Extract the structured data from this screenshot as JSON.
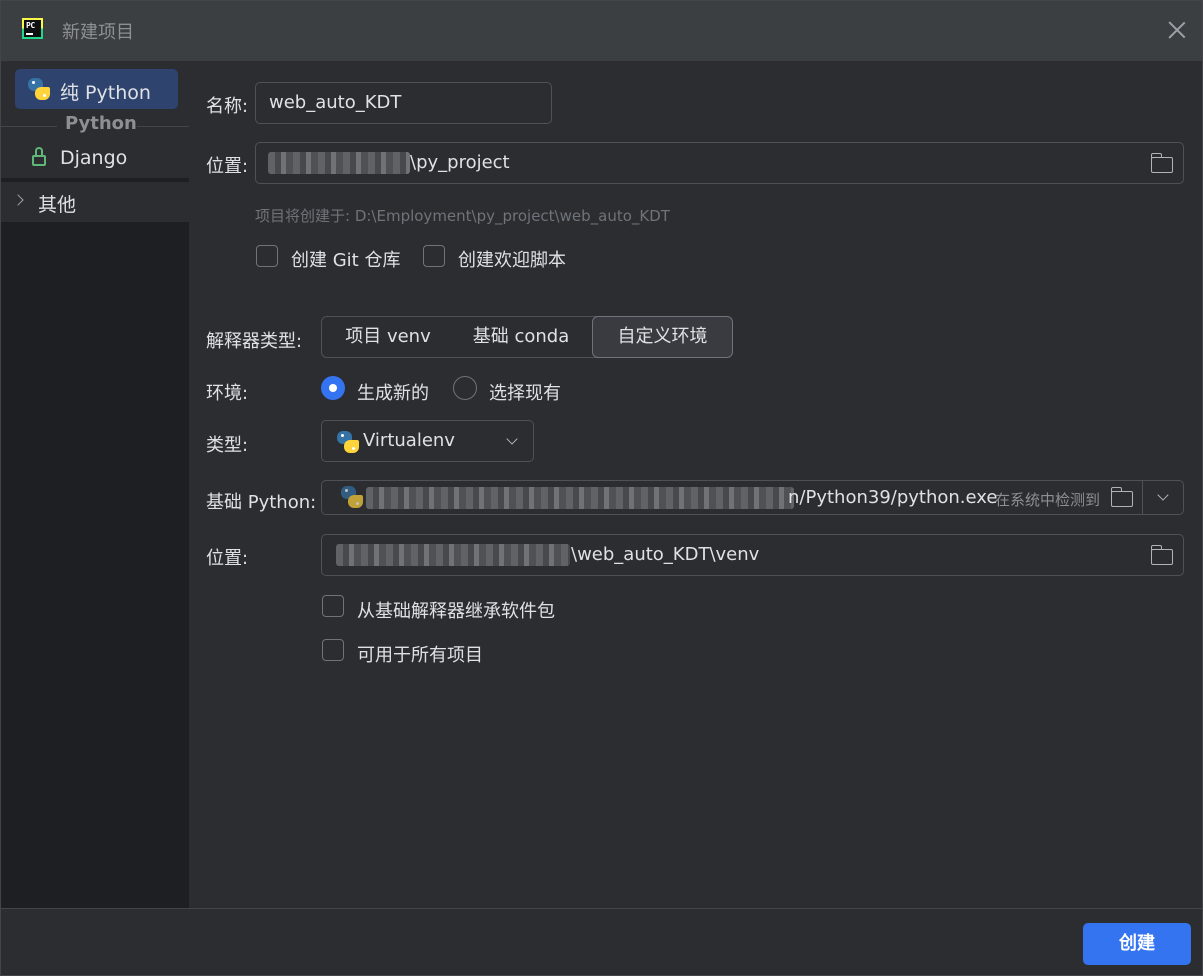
{
  "window": {
    "title": "新建项目"
  },
  "sidebar": {
    "items": [
      {
        "label": "纯 Python",
        "icon": "python-icon",
        "selected": true
      },
      {
        "label": "Django",
        "icon": "lock-icon"
      },
      {
        "label": "其他",
        "icon": "chevron-right-icon"
      }
    ],
    "group_label": "Python"
  },
  "form": {
    "name_label": "名称:",
    "name_value": "web_auto_KDT",
    "location_label": "位置:",
    "location_value": "\\py_project",
    "hint": "项目将创建于: D:\\Employment\\py_project\\web_auto_KDT",
    "git_label": "创建 Git 仓库",
    "welcome_label": "创建欢迎脚本",
    "interp_type_label": "解释器类型:",
    "interp_types": [
      "项目 venv",
      "基础 conda",
      "自定义环境"
    ],
    "interp_selected": "自定义环境",
    "env_label": "环境:",
    "env_new": "生成新的",
    "env_existing": "选择现有",
    "env_selected": "生成新的",
    "type_label": "类型:",
    "type_value": "Virtualenv",
    "base_python_label": "基础 Python:",
    "base_python_value": "n/Python39/python.exe",
    "base_python_detected": "在系统中检测到",
    "venv_location_label": "位置:",
    "venv_location_value": "\\web_auto_KDT\\venv",
    "inherit_label": "从基础解释器继承软件包",
    "all_projects_label": "可用于所有项目"
  },
  "footer": {
    "create_label": "创建"
  },
  "colors": {
    "accent": "#3574f0",
    "background": "#2b2d30",
    "sidebar_selected": "#2e436e"
  }
}
